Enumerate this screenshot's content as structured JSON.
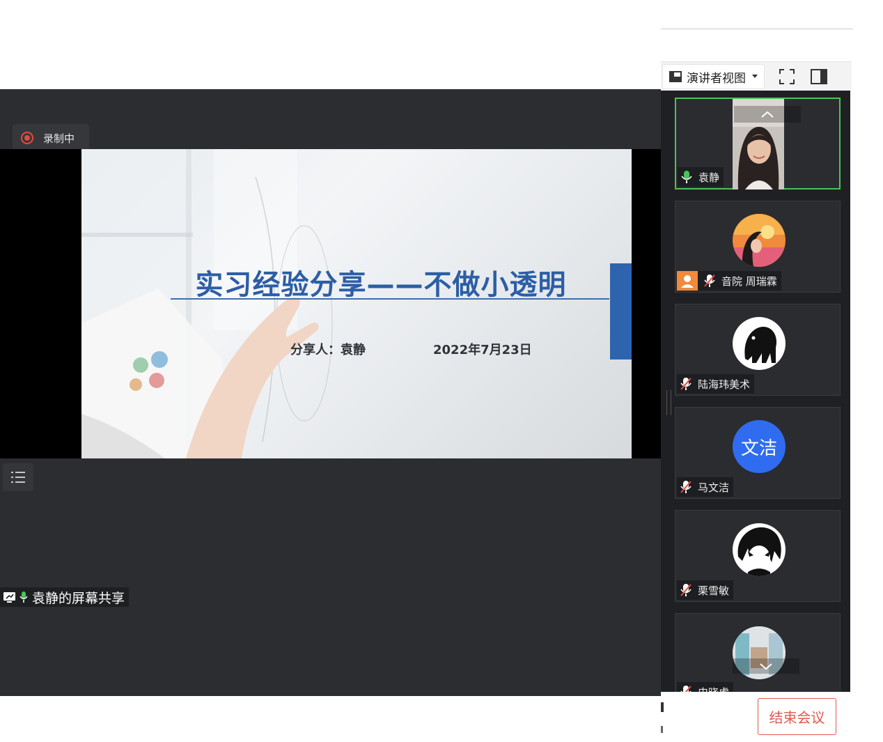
{
  "recording": {
    "label": "录制中"
  },
  "slide": {
    "title": "实习经验分享——不做小透明",
    "presenter": "分享人：袁静",
    "date": "2022年7月23日"
  },
  "share": {
    "label": "袁静的屏幕共享"
  },
  "toolbar": {
    "view_mode": "演讲者视图"
  },
  "participants": [
    {
      "name": "袁静",
      "mic": "on",
      "avatar": "video"
    },
    {
      "name": "音院 周瑞霖",
      "mic": "muted",
      "avatar": "orange-sunset",
      "badge": "host-icon"
    },
    {
      "name": "陆海玮美术",
      "mic": "muted",
      "avatar": "black-creature"
    },
    {
      "name": "马文洁",
      "mic": "muted",
      "avatar": "text",
      "avatar_text": "文洁",
      "avatar_color": "#2f6cf0"
    },
    {
      "name": "栗雪敏",
      "mic": "muted",
      "avatar": "anime-boy"
    },
    {
      "name": "史晓虎",
      "mic": "muted",
      "avatar": "store-photo"
    }
  ],
  "end_meeting": {
    "label": "结束会议"
  },
  "colors": {
    "accent_red": "#e05a50",
    "speaking_green": "#4cc25a",
    "slide_blue": "#2c5ea6"
  }
}
